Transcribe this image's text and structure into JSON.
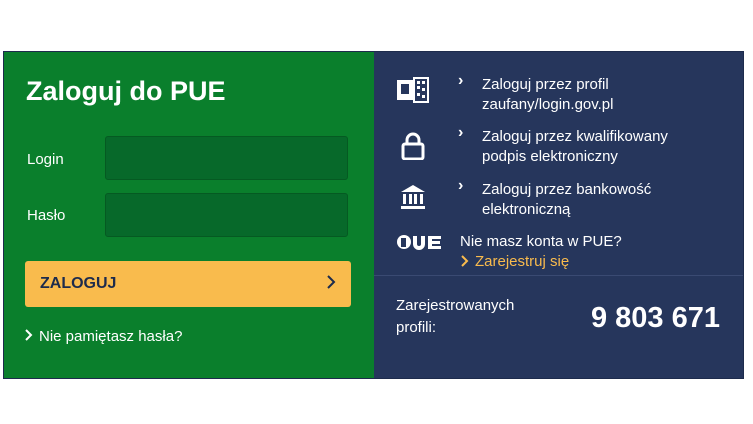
{
  "login": {
    "title": "Zaloguj do PUE",
    "login_label": "Login",
    "login_value": "",
    "password_label": "Hasło",
    "password_value": "",
    "submit_label": "ZALOGUJ",
    "forgot_label": "Nie pamiętasz hasła?"
  },
  "options": [
    {
      "label": "Zaloguj przez profil zaufany/login.gov.pl",
      "icon": "trusted-profile-icon"
    },
    {
      "label": "Zaloguj przez kwalifikowany podpis elektroniczny",
      "icon": "lock-icon"
    },
    {
      "label": "Zaloguj przez bankowość elektroniczną",
      "icon": "bank-icon"
    }
  ],
  "register": {
    "question": "Nie masz konta w PUE?",
    "link_label": "Zarejestruj się"
  },
  "stats": {
    "label": "Zarejestrowanych profili:",
    "value": "9 803 671"
  },
  "colors": {
    "left_panel": "#0a7f2c",
    "right_panel": "#26365c",
    "accent": "#f9bb4d"
  }
}
